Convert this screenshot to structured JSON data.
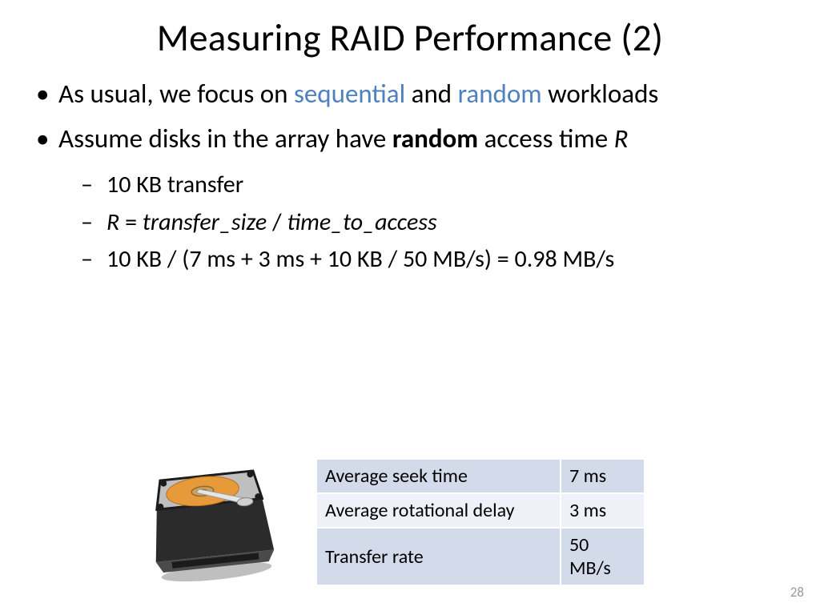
{
  "title": "Measuring RAID Performance (2)",
  "bullets": {
    "b1": {
      "pre": "As usual, we focus on ",
      "hl1": "sequential",
      "mid": " and ",
      "hl2": "random",
      "post": " workloads"
    },
    "b2": {
      "pre": "Assume disks in the array have ",
      "bold": "random",
      "post1": " access time ",
      "ital": "R"
    },
    "sub1": "10 KB transfer",
    "sub2": {
      "r": "R",
      "eq": " = ",
      "a": "transfer_size",
      "sl": " / ",
      "b": "time_to_access"
    },
    "sub3": "10 KB / (7 ms + 3 ms + 10 KB / 50 MB/s) = 0.98 MB/s"
  },
  "table": {
    "r1": {
      "label": "Average seek time",
      "val": "7 ms"
    },
    "r2": {
      "label": "Average rotational delay",
      "val": "3 ms"
    },
    "r3": {
      "label": "Transfer rate",
      "val": "50 MB/s"
    }
  },
  "page": "28"
}
